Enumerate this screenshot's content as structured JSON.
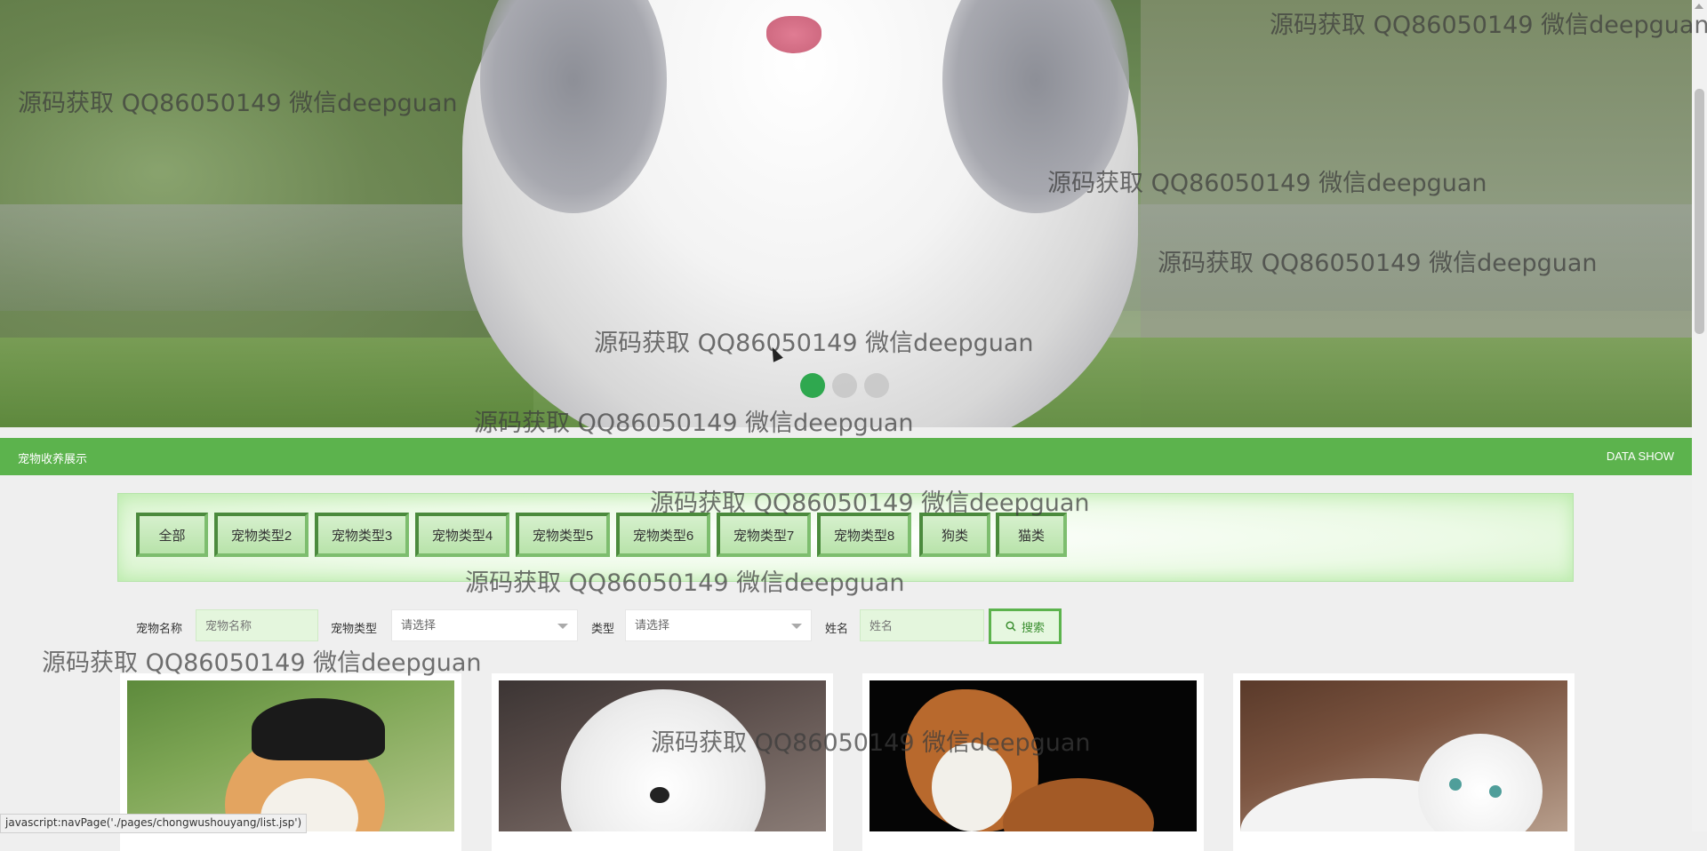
{
  "watermark_text": "源码获取 QQ86050149 微信deepguan",
  "carousel": {
    "slides": 3,
    "active_index": 0
  },
  "section": {
    "title": "宠物收养展示",
    "right_label": "DATA SHOW"
  },
  "categories": [
    "全部",
    "宠物类型2",
    "宠物类型3",
    "宠物类型4",
    "宠物类型5",
    "宠物类型6",
    "宠物类型7",
    "宠物类型8",
    "狗类",
    "猫类"
  ],
  "search": {
    "pet_name_label": "宠物名称",
    "pet_name_placeholder": "宠物名称",
    "pet_type_label": "宠物类型",
    "pet_type_value": "请选择",
    "type_label": "类型",
    "type_value": "请选择",
    "owner_name_label": "姓名",
    "owner_name_placeholder": "姓名",
    "search_button": "搜索"
  },
  "cards": [
    {
      "photo": "corgi in pirate hat"
    },
    {
      "photo": "white bichon"
    },
    {
      "photo": "brown and white puppy"
    },
    {
      "photo": "white scottish fold cat"
    }
  ],
  "status_bar": "javascript:navPage('./pages/chongwushouyang/list.jsp')",
  "colors": {
    "accent_green": "#5cb34d",
    "active_dot": "#2fa84f"
  }
}
